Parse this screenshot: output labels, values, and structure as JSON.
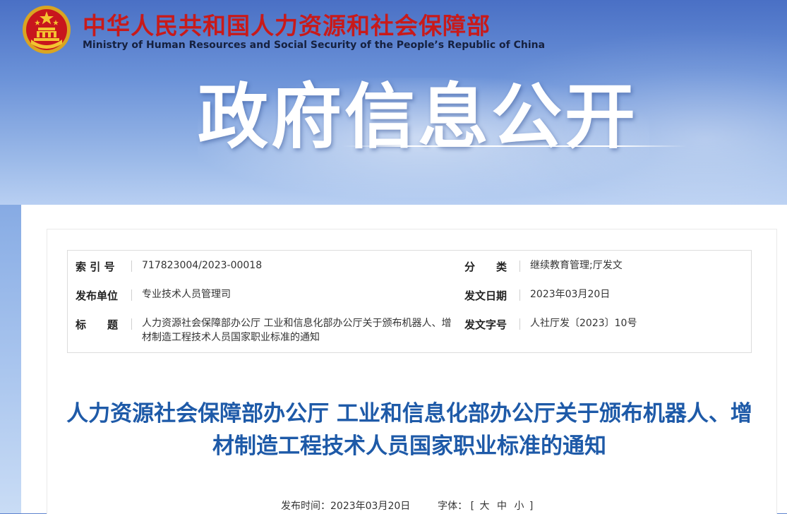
{
  "header": {
    "ministry_cn": "中华人民共和国人力资源和社会保障部",
    "ministry_en": "Ministry of Human Resources and Social Security of the People’s Republic of China",
    "section_title": "政府信息公开",
    "emblem_icon": "national-emblem-icon"
  },
  "meta": {
    "index_label": "索 引 号",
    "index_value": "717823004/2023-00018",
    "category_label": "分　　类",
    "category_value": "继续教育管理;厅发文",
    "issuer_label": "发布单位",
    "issuer_value": "专业技术人员管理司",
    "date_label": "发文日期",
    "date_value": "2023年03月20日",
    "subject_label": "标　　题",
    "subject_value": "人力资源社会保障部办公厅 工业和信息化部办公厅关于颁布机器人、增材制造工程技术人员国家职业标准的通知",
    "doc_no_label": "发文字号",
    "doc_no_value": "人社厅发〔2023〕10号"
  },
  "article": {
    "title": "人力资源社会保障部办公厅 工业和信息化部办公厅关于颁布机器人、增材制造工程技术人员国家职业标准的通知",
    "publish_label": "发布时间：",
    "publish_date": "2023年03月20日",
    "font_label": "字体：",
    "bracket_open": "[",
    "font_large": "大",
    "font_medium": "中",
    "font_small": "小",
    "bracket_close": "]"
  },
  "colors": {
    "brand_red": "#c81a1a",
    "title_blue": "#1e5aa8"
  }
}
